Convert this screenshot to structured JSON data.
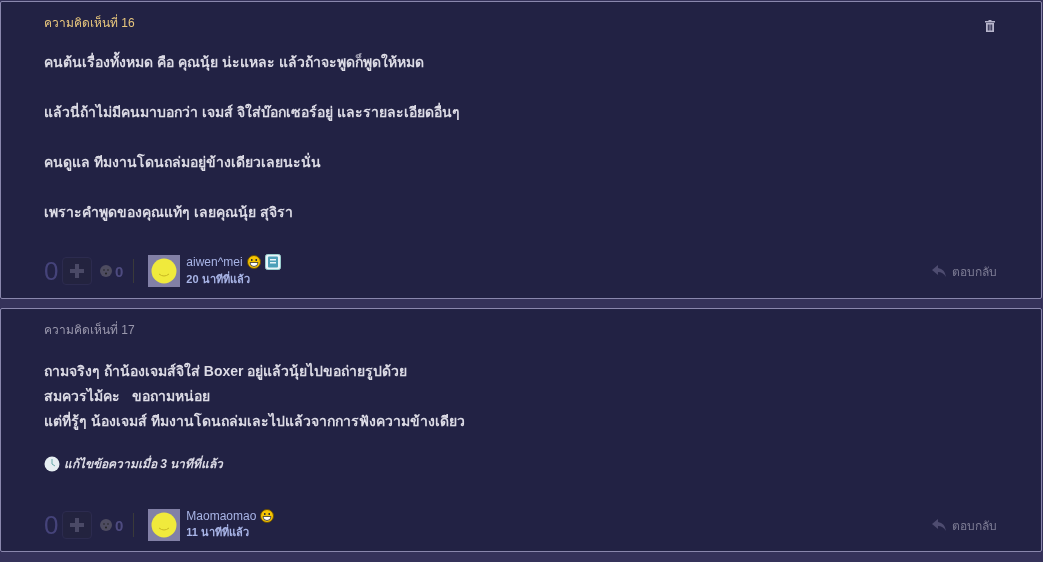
{
  "comments": [
    {
      "title": "ความคิดเห็นที่ 16",
      "highlight": true,
      "deletable": true,
      "spaced": true,
      "lines": [
        "คนต้นเรื่องทั้งหมด คือ คุณนุ้ย น่ะแหละ แล้วถ้าจะพูดก็พูดให้หมด",
        "แล้วนี่ถ้าไม่มีคนมาบอกว่า เจมส์ จิใส่บ๊อกเซอร์อยู่ และรายละเอียดอื่นๆ",
        "คนดูแล ทีมงานโดนถล่มอยู่ข้างเดียวเลยนะนั่น",
        "เพราะคำพูดของคุณแท้ๆ เลยคุณนุ้ย สุจิรา"
      ],
      "score": "0",
      "emotion_count": "0",
      "author": "aiwen^mei",
      "badges": [
        {
          "kind": "grin"
        },
        {
          "kind": "book"
        }
      ],
      "time": "20 นาทีที่แล้ว",
      "reply": "ตอบกลับ"
    },
    {
      "title": "ความคิดเห็นที่ 17",
      "highlight": false,
      "deletable": false,
      "spaced": false,
      "lines": [
        "ถามจริงๆ ถ้าน้องเจมส์จิใส่ Boxer อยู่แล้วนุ้ยไปขอถ่ายรูปด้วย",
        "สมควรไม้คะ   ขอถามหน่อย",
        "แต่ที่รู้ๆ น้องเจมส์ ทีมงานโดนถล่มเละไปแล้วจากการฟังความข้างเดียว"
      ],
      "edited": "แก้ไขข้อความเมื่อ 3 นาทีที่แล้ว",
      "score": "0",
      "emotion_count": "0",
      "author": "Maomaomao",
      "badges": [
        {
          "kind": "grin"
        }
      ],
      "time": "11 นาทีที่แล้ว",
      "reply": "ตอบกลับ"
    }
  ]
}
